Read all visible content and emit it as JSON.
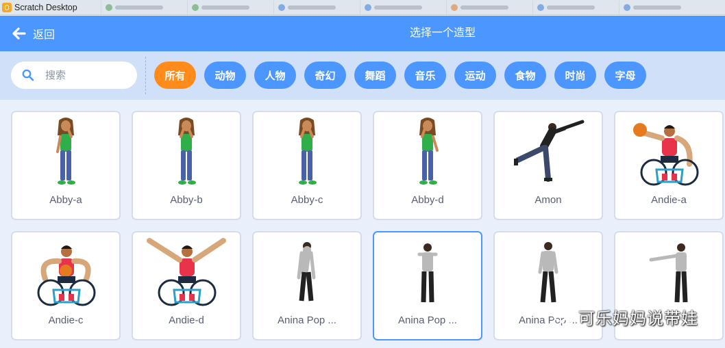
{
  "window": {
    "title": "Scratch Desktop",
    "app_icon": "scratch-cat-icon"
  },
  "header": {
    "back_label": "返回",
    "back_icon": "arrow-left-icon",
    "title": "选择一个造型"
  },
  "search": {
    "placeholder": "搜索",
    "icon": "search-icon"
  },
  "tags": [
    {
      "label": "所有",
      "active": true
    },
    {
      "label": "动物",
      "active": false
    },
    {
      "label": "人物",
      "active": false
    },
    {
      "label": "奇幻",
      "active": false
    },
    {
      "label": "舞蹈",
      "active": false
    },
    {
      "label": "音乐",
      "active": false
    },
    {
      "label": "运动",
      "active": false
    },
    {
      "label": "食物",
      "active": false
    },
    {
      "label": "时尚",
      "active": false
    },
    {
      "label": "字母",
      "active": false
    }
  ],
  "costumes": [
    {
      "name": "Abby-a",
      "icon": "abby-figure",
      "selected": false
    },
    {
      "name": "Abby-b",
      "icon": "abby-figure",
      "selected": false
    },
    {
      "name": "Abby-c",
      "icon": "abby-figure",
      "selected": false
    },
    {
      "name": "Abby-d",
      "icon": "abby-figure",
      "selected": false
    },
    {
      "name": "Amon",
      "icon": "dancer-figure",
      "selected": false
    },
    {
      "name": "Andie-a",
      "icon": "wheelchair-basketball-figure",
      "selected": false
    },
    {
      "name": "Andie-c",
      "icon": "wheelchair-basketball-figure",
      "selected": false
    },
    {
      "name": "Andie-d",
      "icon": "wheelchair-basketball-figure",
      "selected": false
    },
    {
      "name": "Anina Pop ...",
      "icon": "anina-figure",
      "selected": false
    },
    {
      "name": "Anina Pop ...",
      "icon": "anina-figure",
      "selected": true
    },
    {
      "name": "Anina Pop ...",
      "icon": "anina-figure",
      "selected": false
    },
    {
      "name": "",
      "icon": "anina-figure",
      "selected": false
    }
  ],
  "watermark": {
    "text": "可乐妈妈说带娃",
    "icon": "wechat-icon"
  },
  "colors": {
    "header_blue": "#4c97ff",
    "active_orange": "#ff8c1a",
    "filter_bg": "#cfe0f8",
    "grid_bg": "#e8f0fb",
    "card_border": "#d6dde8",
    "label_text": "#575e75"
  }
}
